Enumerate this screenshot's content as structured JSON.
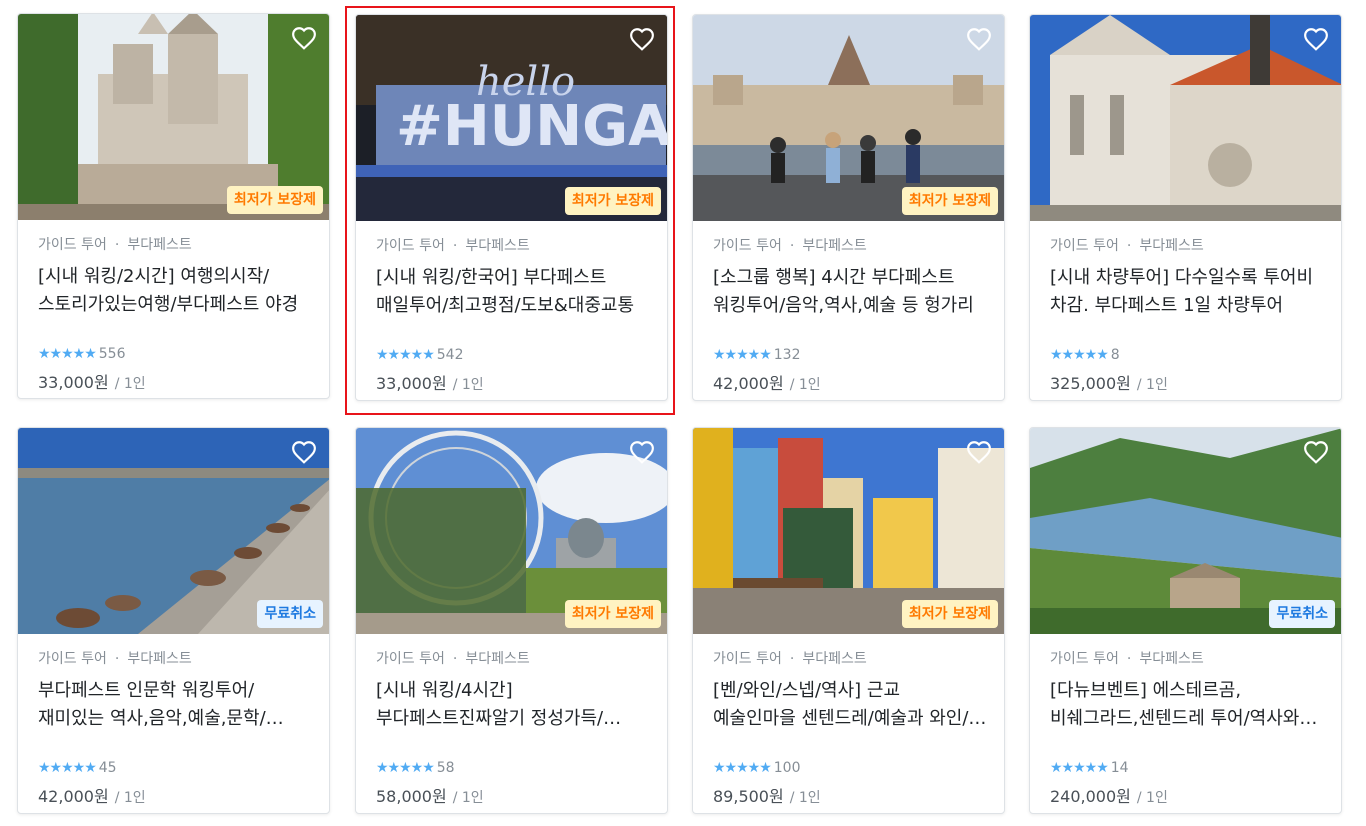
{
  "badges": {
    "lowest_price": "최저가 보장제",
    "free_cancel": "무료취소"
  },
  "colors": {
    "star": "#51abf3",
    "badge_orange_bg": "#fff3c2",
    "badge_orange_text": "#ff7a00",
    "badge_blue_bg": "#e7f3ff",
    "badge_blue_text": "#1f7ae0",
    "selection_outline": "#e8141a"
  },
  "selected_card_index": 1,
  "cards": [
    {
      "image": "fishermans-bastion-photo",
      "badge": "최저가 보장제",
      "category": "가이드 투어",
      "city": "부다페스트",
      "title": "[시내 워킹/2시간] 여행의시작/스토리가있는여행/부다페스트 야경",
      "rating": "5 stars",
      "review_count": "556",
      "price": "33,000원",
      "unit": "/ 1인"
    },
    {
      "image": "hello-hungary-sign-photo",
      "badge": "최저가 보장제",
      "category": "가이드 투어",
      "city": "부다페스트",
      "title": "[시내 워킹/한국어] 부다페스트 매일투어/최고평점/도보&대중교통",
      "rating": "5 stars",
      "review_count": "542",
      "price": "33,000원",
      "unit": "/ 1인"
    },
    {
      "image": "parliament-photo",
      "badge": "최저가 보장제",
      "category": "가이드 투어",
      "city": "부다페스트",
      "title": "[소그룹 행복] 4시간 부다페스트 워킹투어/음악,역사,예술 등 헝가리",
      "rating": "5 stars",
      "review_count": "132",
      "price": "42,000원",
      "unit": "/ 1인"
    },
    {
      "image": "matthias-church-photo",
      "badge": "",
      "category": "가이드 투어",
      "city": "부다페스트",
      "title": "[시내 차량투어] 다수일수록 투어비 차감. 부다페스트 1일 차량투어",
      "rating": "5 stars",
      "review_count": "8",
      "price": "325,000원",
      "unit": "/ 1인"
    },
    {
      "image": "danube-shoes-photo",
      "badge": "무료취소",
      "category": "가이드 투어",
      "city": "부다페스트",
      "title": "부다페스트 인문학 워킹투어/재미있는 역사,음악,예술,문학/스토리",
      "rating": "5 stars",
      "review_count": "45",
      "price": "42,000원",
      "unit": "/ 1인"
    },
    {
      "image": "ferris-wheel-photo",
      "badge": "최저가 보장제",
      "category": "가이드 투어",
      "city": "부다페스트",
      "title": "[시내 워킹/4시간] 부다페스트진짜알기 정성가득/이것이투어다 완전정복",
      "rating": "5 stars",
      "review_count": "58",
      "price": "58,000원",
      "unit": "/ 1인"
    },
    {
      "image": "szentendre-street-photo",
      "badge": "최저가 보장제",
      "category": "가이드 투어",
      "city": "부다페스트",
      "title": "[벤/와인/스넵/역사] 근교 예술인마을 센텐드레/예술과 와인/행복",
      "rating": "5 stars",
      "review_count": "100",
      "price": "89,500원",
      "unit": "/ 1인"
    },
    {
      "image": "danube-bend-photo",
      "badge": "무료취소",
      "category": "가이드 투어",
      "city": "부다페스트",
      "title": "[다뉴브벤트] 에스테르곰,비쉐그라드,센텐드레 투어/역사와 자연",
      "rating": "5 stars",
      "review_count": "14",
      "price": "240,000원",
      "unit": "/ 1인"
    }
  ]
}
